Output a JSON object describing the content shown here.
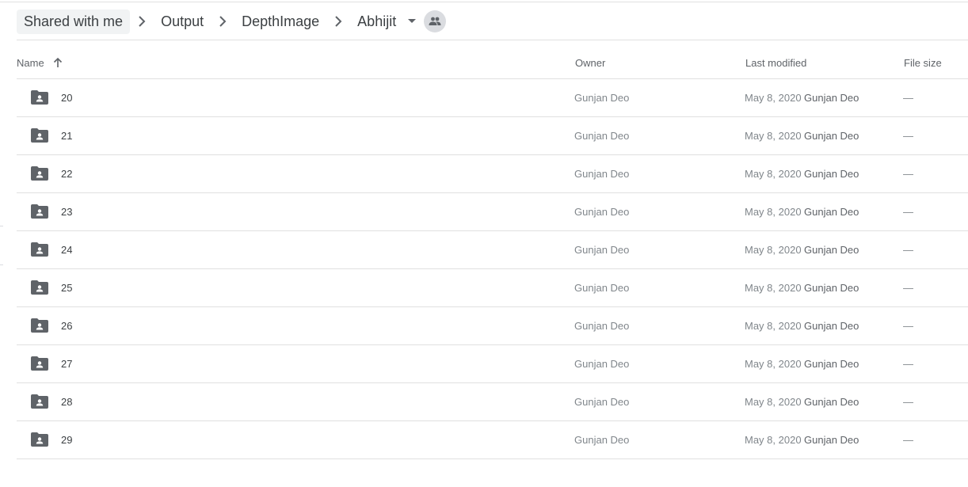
{
  "breadcrumb": {
    "items": [
      "Shared with me",
      "Output",
      "DepthImage",
      "Abhijit"
    ]
  },
  "columns": {
    "name": "Name",
    "owner": "Owner",
    "last_modified": "Last modified",
    "file_size": "File size"
  },
  "rows": [
    {
      "name": "20",
      "owner": "Gunjan Deo",
      "date": "May 8, 2020",
      "modified_by": "Gunjan Deo",
      "size": "—"
    },
    {
      "name": "21",
      "owner": "Gunjan Deo",
      "date": "May 8, 2020",
      "modified_by": "Gunjan Deo",
      "size": "—"
    },
    {
      "name": "22",
      "owner": "Gunjan Deo",
      "date": "May 8, 2020",
      "modified_by": "Gunjan Deo",
      "size": "—"
    },
    {
      "name": "23",
      "owner": "Gunjan Deo",
      "date": "May 8, 2020",
      "modified_by": "Gunjan Deo",
      "size": "—"
    },
    {
      "name": "24",
      "owner": "Gunjan Deo",
      "date": "May 8, 2020",
      "modified_by": "Gunjan Deo",
      "size": "—"
    },
    {
      "name": "25",
      "owner": "Gunjan Deo",
      "date": "May 8, 2020",
      "modified_by": "Gunjan Deo",
      "size": "—"
    },
    {
      "name": "26",
      "owner": "Gunjan Deo",
      "date": "May 8, 2020",
      "modified_by": "Gunjan Deo",
      "size": "—"
    },
    {
      "name": "27",
      "owner": "Gunjan Deo",
      "date": "May 8, 2020",
      "modified_by": "Gunjan Deo",
      "size": "—"
    },
    {
      "name": "28",
      "owner": "Gunjan Deo",
      "date": "May 8, 2020",
      "modified_by": "Gunjan Deo",
      "size": "—"
    },
    {
      "name": "29",
      "owner": "Gunjan Deo",
      "date": "May 8, 2020",
      "modified_by": "Gunjan Deo",
      "size": "—"
    }
  ],
  "icons": {
    "separator": "chevron-right-icon",
    "caret": "arrow-drop-down-icon",
    "shared": "people-icon",
    "sort": "arrow-up-icon",
    "folder": "shared-folder-icon"
  },
  "colors": {
    "folder": "#5f6368",
    "active_crumb_bg": "#f1f3f4",
    "divider": "#e0e0e0"
  }
}
